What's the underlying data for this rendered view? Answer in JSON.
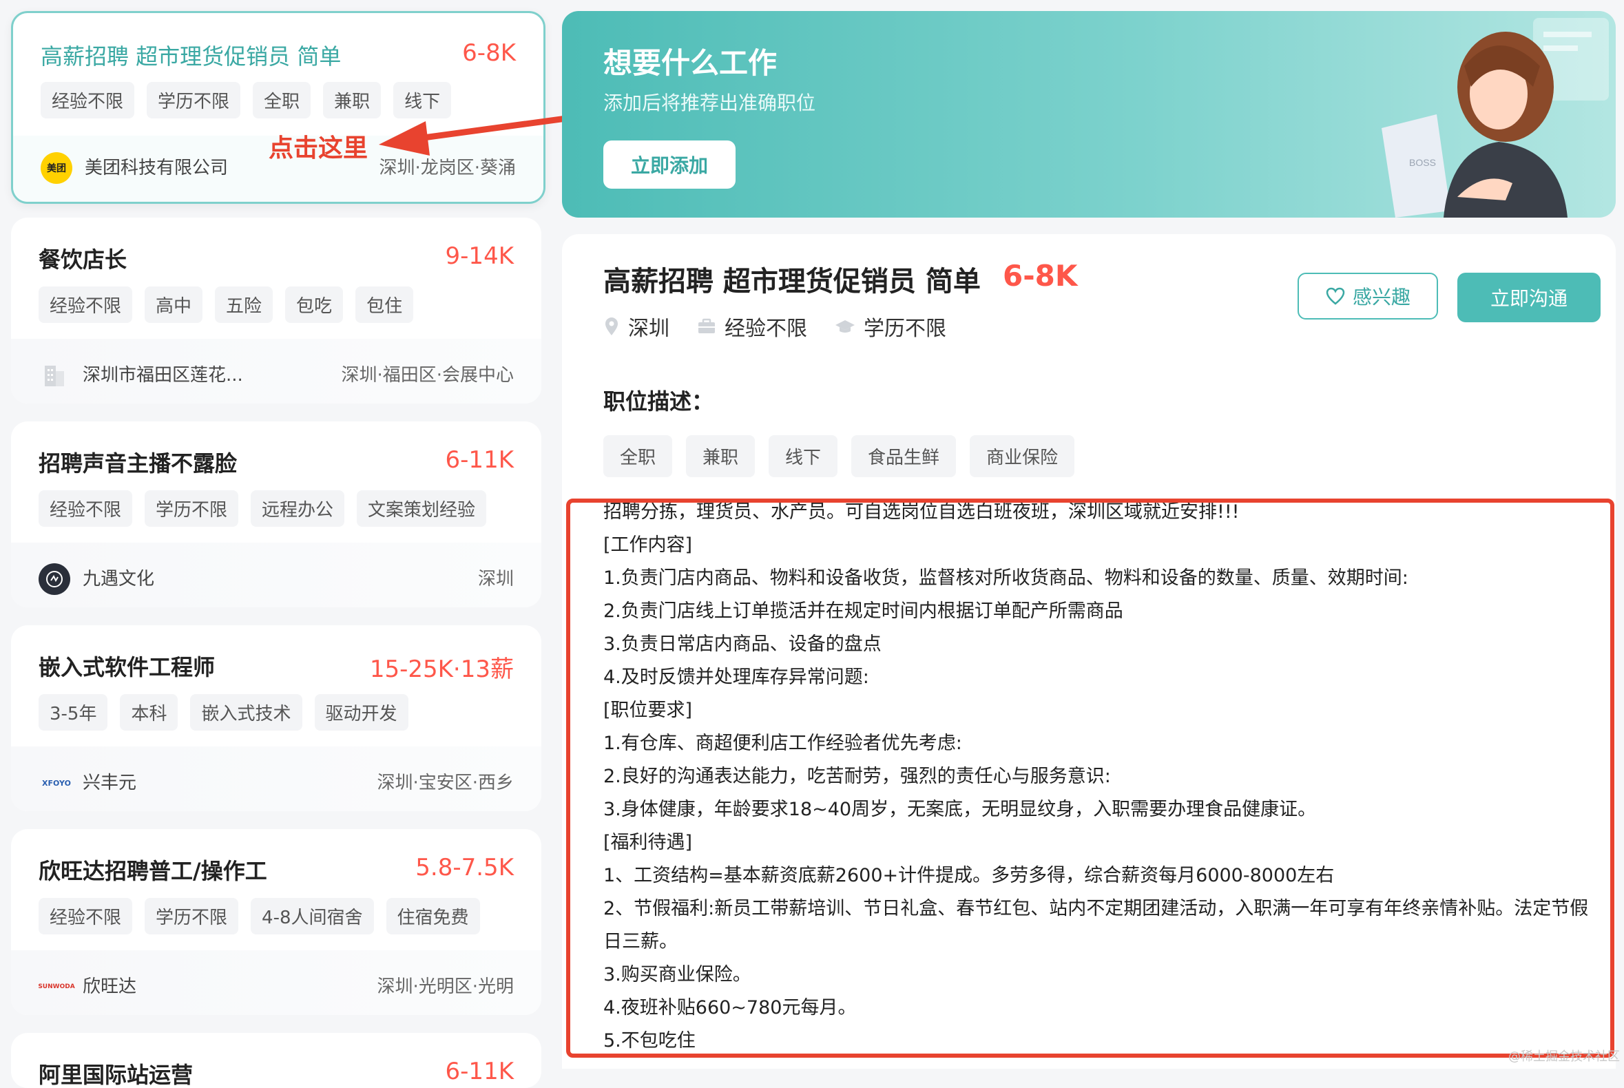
{
  "jobs": [
    {
      "title": "高薪招聘 超市理货促销员 简单",
      "salary": "6-8K",
      "tags": [
        "经验不限",
        "学历不限",
        "全职",
        "兼职",
        "线下"
      ],
      "company": "美团科技有限公司",
      "location": "深圳·龙岗区·葵涌",
      "logo_text": "美团"
    },
    {
      "title": "餐饮店长",
      "salary": "9-14K",
      "tags": [
        "经验不限",
        "高中",
        "五险",
        "包吃",
        "包住"
      ],
      "company": "深圳市福田区莲花...",
      "location": "深圳·福田区·会展中心",
      "logo_text": ""
    },
    {
      "title": "招聘声音主播不露脸",
      "salary": "6-11K",
      "tags": [
        "经验不限",
        "学历不限",
        "远程办公",
        "文案策划经验"
      ],
      "company": "九遇文化",
      "location": "深圳",
      "logo_text": ""
    },
    {
      "title": "嵌入式软件工程师",
      "salary": "15-25K·13薪",
      "tags": [
        "3-5年",
        "本科",
        "嵌入式技术",
        "驱动开发"
      ],
      "company": "兴丰元",
      "location": "深圳·宝安区·西乡",
      "logo_text": "XFOYO"
    },
    {
      "title": "欣旺达招聘普工/操作工",
      "salary": "5.8-7.5K",
      "tags": [
        "经验不限",
        "学历不限",
        "4-8人间宿舍",
        "住宿免费"
      ],
      "company": "欣旺达",
      "location": "深圳·光明区·光明",
      "logo_text": "SUNWODA"
    },
    {
      "title": "阿里国际站运营",
      "salary": "6-11K"
    }
  ],
  "annotation": {
    "click_here": "点击这里"
  },
  "banner": {
    "title": "想要什么工作",
    "subtitle": "添加后将推荐出准确职位",
    "button": "立即添加",
    "laptop_text": "BOSS"
  },
  "detail": {
    "title": "高薪招聘 超市理货促销员 简单",
    "salary": "6-8K",
    "interest_button": "感兴趣",
    "chat_button": "立即沟通",
    "city": "深圳",
    "experience": "经验不限",
    "education": "学历不限",
    "section_title": "职位描述：",
    "tags": [
      "全职",
      "兼职",
      "线下",
      "食品生鲜",
      "商业保险"
    ],
    "description": [
      "招聘分拣，理货员、水产员。可自选岗位自选白班夜班，深圳区域就近安排!!!",
      "[工作内容]",
      "1.负责门店内商品、物料和设备收货，监督核对所收货商品、物料和设备的数量、质量、效期时间:",
      "2.负责门店线上订单揽活并在规定时间内根据订单配产所需商品",
      "3.负责日常店内商品、设备的盘点",
      "4.及时反馈并处理库存异常问题:",
      "[职位要求]",
      "1.有仓库、商超便利店工作经验者优先考虑:",
      "2.良好的沟通表达能力，吃苦耐劳，强烈的责任心与服务意识:",
      "3.身体健康，年龄要求18~40周岁，无案底，无明显纹身，入职需要办理食品健康证。",
      "[福利待遇]",
      "1、工资结构=基本薪资底薪2600+计件提成。多劳多得，综合薪资每月6000-8000左右",
      "2、节假福利:新员工带薪培训、节日礼盒、春节红包、站内不定期团建活动，入职满一年可享有年终亲情补贴。法定节假日三薪。",
      "3.购买商业保险。",
      "4.夜班补贴660~780元每月。",
      "5.不包吃住"
    ]
  },
  "watermark": "@稀土掘金技术社区",
  "colors": {
    "accent": "#4dbcb6",
    "salary": "#fe574a",
    "annotation": "#e8432f"
  }
}
